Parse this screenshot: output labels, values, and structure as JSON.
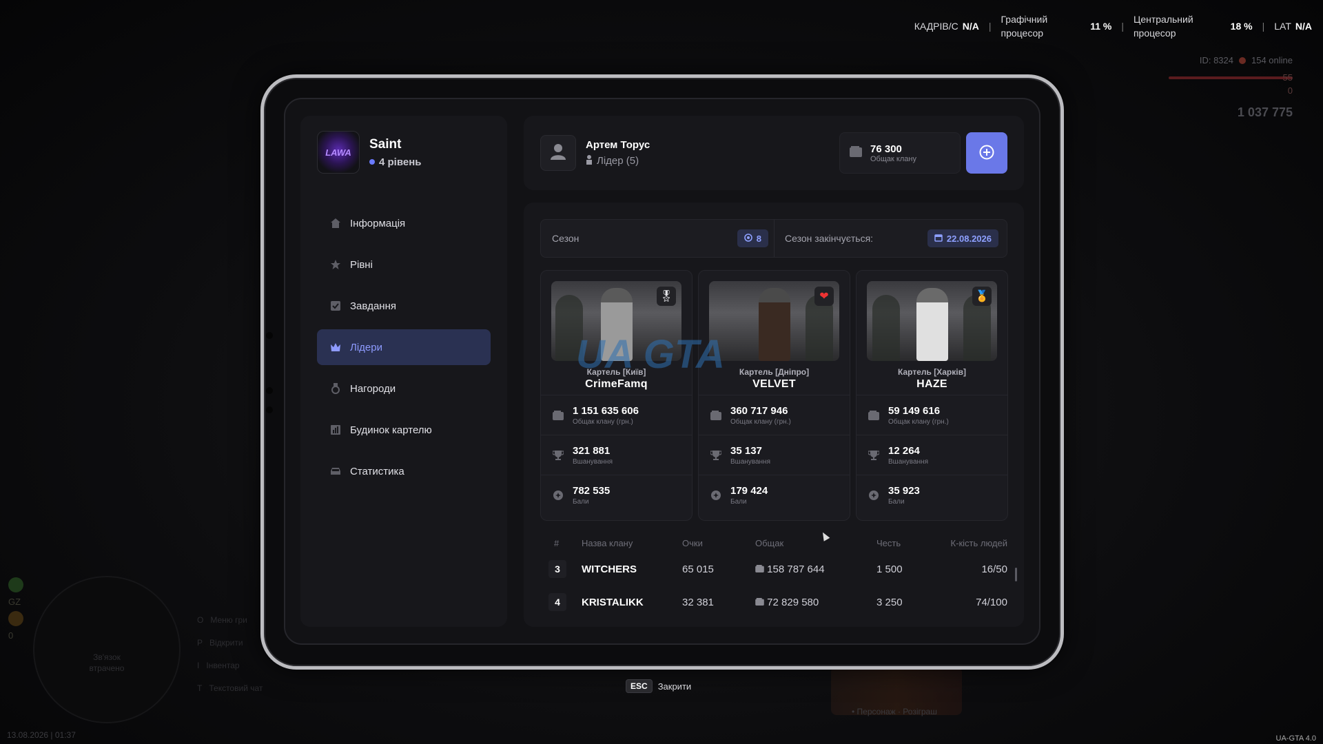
{
  "hud": {
    "fps_label": "КАДРІВ/С",
    "fps_value": "N/A",
    "gpu_label_1": "Графічний",
    "gpu_label_2": "процесор",
    "gpu_value": "11 %",
    "cpu_label_1": "Центральний",
    "cpu_label_2": "процесор",
    "cpu_value": "18 %",
    "lat_label": "LAT",
    "lat_value": "N/A",
    "player_id": "ID: 8324",
    "online": "154 online",
    "hp": "55",
    "armor": "0",
    "money": "1 037 775",
    "datetime": "13.08.2026 | 01:37",
    "version": "UA-GTA 4.0",
    "minimap_text_1": "Зв'язок",
    "minimap_text_2": "втрачено",
    "hud_gz": "GZ",
    "hud_zero": "0",
    "keys": [
      {
        "key": "O",
        "label": "Меню гри"
      },
      {
        "key": "P",
        "label": "Відкрити"
      },
      {
        "key": "I",
        "label": "Інвентар"
      },
      {
        "key": "T",
        "label": "Текстовий чат"
      }
    ],
    "promo_text": "• Персонаж · Розіграш"
  },
  "profile": {
    "name": "Saint",
    "level": "4 рівень",
    "avatar_text": "LAWA"
  },
  "sidebar": {
    "items": [
      {
        "label": "Інформація",
        "icon": "home-icon"
      },
      {
        "label": "Рівні",
        "icon": "star-icon"
      },
      {
        "label": "Завдання",
        "icon": "checkbox-icon"
      },
      {
        "label": "Лідери",
        "icon": "crown-icon",
        "active": true
      },
      {
        "label": "Нагороди",
        "icon": "medal-icon"
      },
      {
        "label": "Будинок картелю",
        "icon": "building-icon"
      },
      {
        "label": "Статистика",
        "icon": "car-icon"
      }
    ]
  },
  "leader": {
    "name": "Артем Торус",
    "role": "Лідер (5)"
  },
  "fund": {
    "value": "76 300",
    "label": "Общак клану"
  },
  "season": {
    "label": "Сезон",
    "number": "8",
    "ends_label": "Сезон закінчується:",
    "ends_date": "22.08.2026"
  },
  "cards": [
    {
      "clan": "Картель [Київ]",
      "name": "CrimeFamq",
      "badge": "🎖",
      "fund": "1 151 635 606",
      "fund_label": "Общак клану (грн.)",
      "honor": "321 881",
      "honor_label": "Вшанування",
      "points": "782 535",
      "points_label": "Бали"
    },
    {
      "clan": "Картель [Дніпро]",
      "name": "VELVET",
      "badge": "❤",
      "fund": "360 717 946",
      "fund_label": "Общак клану (грн.)",
      "honor": "35 137",
      "honor_label": "Вшанування",
      "points": "179 424",
      "points_label": "Бали"
    },
    {
      "clan": "Картель [Харків]",
      "name": "HAZE",
      "badge": "🏅",
      "fund": "59 149 616",
      "fund_label": "Общак клану (грн.)",
      "honor": "12 264",
      "honor_label": "Вшанування",
      "points": "35 923",
      "points_label": "Бали"
    }
  ],
  "table": {
    "headers": [
      "#",
      "Назва клану",
      "Очки",
      "Общак",
      "Честь",
      "К-кість людей"
    ],
    "rows": [
      {
        "rank": "3",
        "name": "WITCHERS",
        "points": "65 015",
        "fund": "158 787 644",
        "honor": "1 500",
        "members": "16/50"
      },
      {
        "rank": "4",
        "name": "KRISTALIKK",
        "points": "32 381",
        "fund": "72 829 580",
        "honor": "3 250",
        "members": "74/100"
      }
    ]
  },
  "close": {
    "key": "ESC",
    "label": "Закрити"
  },
  "watermark": "UA GTA"
}
